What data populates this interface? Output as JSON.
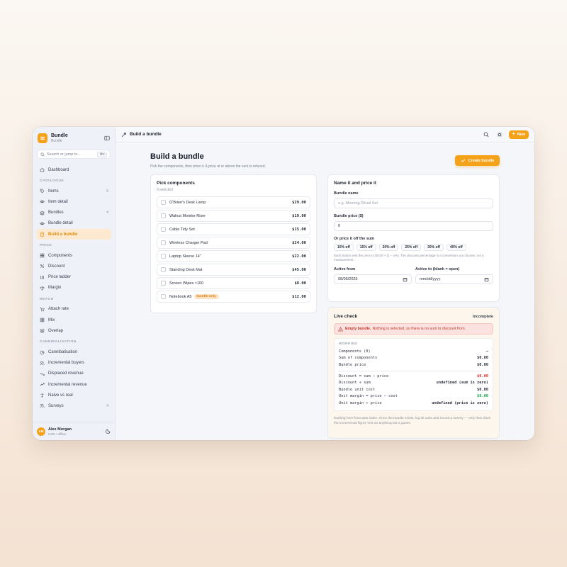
{
  "brand": {
    "title": "Bundle",
    "subtitle": "Bundle"
  },
  "search": {
    "placeholder": "Search or jump to...",
    "shortcut": "⌘K"
  },
  "nav": {
    "dashboard": "Dashboard",
    "catalogue_section": "CATALOGUE",
    "items": "Items",
    "items_count": "6",
    "item_detail": "Item detail",
    "bundles": "Bundles",
    "bundles_count": "4",
    "bundle_detail": "Bundle detail",
    "build_bundle": "Build a bundle",
    "price_section": "PRICE",
    "components": "Components",
    "discount": "Discount",
    "price_ladder": "Price ladder",
    "margin": "Margin",
    "reach_section": "REACH",
    "attach_rate": "Attach rate",
    "mix": "Mix",
    "overlap": "Overlap",
    "cannibalisation_section": "CANNIBALISATION",
    "cannibalisation": "Cannibalisation",
    "incremental_buyers": "Incremental buyers",
    "displaced_revenue": "Displaced revenue",
    "incremental_revenue": "Incremental revenue",
    "naive_vs_real": "Naive vs real",
    "surveys": "Surveys",
    "surveys_count": "4"
  },
  "user": {
    "initials": "AM",
    "name": "Alex Morgan",
    "sub": "USD • offline"
  },
  "topbar": {
    "breadcrumb": "Build a bundle",
    "new_label": "New"
  },
  "page": {
    "title": "Build a bundle",
    "subtitle": "Pick the components, then price it. A price at or above the sum is refused.",
    "create_label": "Create bundle"
  },
  "components_card": {
    "title": "Pick components",
    "selected": "0 selected",
    "items": [
      {
        "name": "O'Brien's Desk Lamp",
        "price": "$29.00",
        "tag": ""
      },
      {
        "name": "Walnut Monitor Riser",
        "price": "$19.00",
        "tag": ""
      },
      {
        "name": "Cable Tidy Set",
        "price": "$15.00",
        "tag": ""
      },
      {
        "name": "Wireless Charger Pad",
        "price": "$24.00",
        "tag": ""
      },
      {
        "name": "Laptop Sleeve 14\"",
        "price": "$22.00",
        "tag": ""
      },
      {
        "name": "Standing Desk Mat",
        "price": "$45.00",
        "tag": ""
      },
      {
        "name": "Screen Wipes ×100",
        "price": "$8.00",
        "tag": ""
      },
      {
        "name": "Notebook A5",
        "price": "$12.00",
        "tag": "bundle-only"
      }
    ]
  },
  "name_card": {
    "title": "Name it and price it",
    "name_label": "Bundle name",
    "name_placeholder": "e.g. Morning Ritual Set",
    "price_label": "Bundle price ($)",
    "price_value": "0",
    "discount_label": "Or price it off the sum",
    "discount_options": [
      "10% off",
      "15% off",
      "20% off",
      "25% off",
      "30% off",
      "40% off"
    ],
    "hint": "Each button sets the price to $0.00 × (1 − x%). The discount percentage is a convention you choose, not a measurement.",
    "active_from_label": "Active from",
    "active_from_value": "08/05/2026",
    "active_to_label": "Active to (blank = open)",
    "active_to_value": "mm/dd/yyyy"
  },
  "live_check": {
    "title": "Live check",
    "status": "Incomplete",
    "alert_title": "Empty bundle.",
    "alert_text": "Nothing is selected, so there is no sum to discount from.",
    "working_title": "WORKING",
    "rows_a": [
      {
        "label": "Components (0)",
        "value": "—"
      },
      {
        "label": "Sum of components",
        "value": "$0.00"
      },
      {
        "label": "Bundle price",
        "value": "$0.00"
      }
    ],
    "rows_b": [
      {
        "label": "Discount = sum − price",
        "value": "$0.00",
        "color": "#d9342b"
      },
      {
        "label": "Discount ÷ sum",
        "value": "undefined (sum is zero)",
        "color": ""
      },
      {
        "label": "Bundle unit cost",
        "value": "$0.00",
        "color": ""
      },
      {
        "label": "Unit margin = price − cost",
        "value": "$0.00",
        "color": "#16a34a"
      },
      {
        "label": "Unit margin ÷ price",
        "value": "undefined (price is zero)",
        "color": ""
      }
    ],
    "footnote": "Nothing here forecasts sales. Once the bundle exists, log its units and record a survey — only then does the incremental figure rest on anything but a guess."
  },
  "colors": {
    "accent": "#f5a21b",
    "danger": "#d9342b",
    "success": "#16a34a"
  }
}
